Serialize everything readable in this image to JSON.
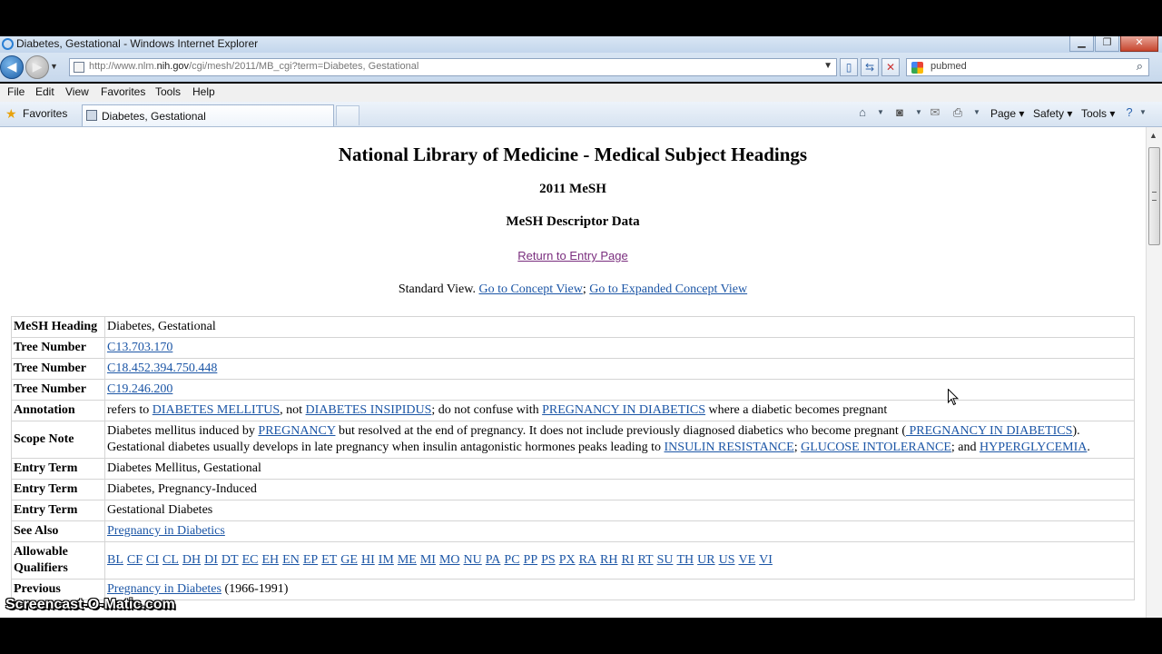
{
  "window": {
    "title": "Diabetes, Gestational - Windows Internet Explorer",
    "buttons": {
      "minimize": "▁",
      "maximize": "❐",
      "close": "✕"
    }
  },
  "address_bar": {
    "url_prefix": "http://www.nlm.",
    "url_domain": "nih.gov",
    "url_rest": "/cgi/mesh/2011/MB_cgi?term=Diabetes, Gestational"
  },
  "search": {
    "value": "pubmed"
  },
  "menu": [
    "File",
    "Edit",
    "View",
    "Favorites",
    "Tools",
    "Help"
  ],
  "favorites_label": "Favorites",
  "tab": {
    "title": "Diabetes, Gestational"
  },
  "command_bar": {
    "page": "Page",
    "safety": "Safety",
    "tools": "Tools"
  },
  "page": {
    "heading": "National Library of Medicine - Medical Subject Headings",
    "year": "2011 MeSH",
    "subheading": "MeSH Descriptor Data",
    "return_link": "Return to Entry Page",
    "view_prefix": "Standard View.",
    "concept_link": "Go to Concept View",
    "view_sep": ";",
    "expanded_link": "Go to Expanded Concept View",
    "rows": {
      "heading_label": "MeSH Heading",
      "heading_value": "Diabetes, Gestational",
      "tree_label": "Tree Number",
      "tree1": "C13.703.170",
      "tree2": "C18.452.394.750.448",
      "tree3": "C19.246.200",
      "annotation_label": "Annotation",
      "annotation": {
        "t1": "refers to ",
        "l1": "DIABETES MELLITUS",
        "t2": ", not ",
        "l2": "DIABETES INSIPIDUS",
        "t3": "; do not confuse with ",
        "l3": "PREGNANCY IN DIABETICS",
        "t4": " where a diabetic becomes pregnant"
      },
      "scope_label": "Scope Note",
      "scope": {
        "t1": "Diabetes mellitus induced by ",
        "l1": "PREGNANCY",
        "t2": " but resolved at the end of pregnancy. It does not include previously diagnosed diabetics who become pregnant (",
        "l2": " PREGNANCY IN DIABETICS",
        "t3": "). Gestational diabetes usually develops in late pregnancy when insulin antagonistic hormones peaks leading to ",
        "l3": "INSULIN RESISTANCE",
        "t4": "; ",
        "l4": "GLUCOSE INTOLERANCE",
        "t5": "; and ",
        "l5": "HYPERGLYCEMIA",
        "t6": "."
      },
      "entry_label": "Entry Term",
      "entry1": "Diabetes Mellitus, Gestational",
      "entry2": "Diabetes, Pregnancy-Induced",
      "entry3": "Gestational Diabetes",
      "see_also_label": "See Also",
      "see_also": "Pregnancy in Diabetics",
      "qualifiers_label": "Allowable Qualifiers",
      "qualifiers": [
        "BL",
        "CF",
        "CI",
        "CL",
        "DH",
        "DI",
        "DT",
        "EC",
        "EH",
        "EN",
        "EP",
        "ET",
        "GE",
        "HI",
        "IM",
        "ME",
        "MI",
        "MO",
        "NU",
        "PA",
        "PC",
        "PP",
        "PS",
        "PX",
        "RA",
        "RH",
        "RI",
        "RT",
        "SU",
        "TH",
        "UR",
        "US",
        "VE",
        "VI"
      ],
      "previous_label": "Previous",
      "previous_link": "Pregnancy in Diabetes",
      "previous_years": " (1966-1991)"
    }
  },
  "watermark": "Screencast-O-Matic.com"
}
